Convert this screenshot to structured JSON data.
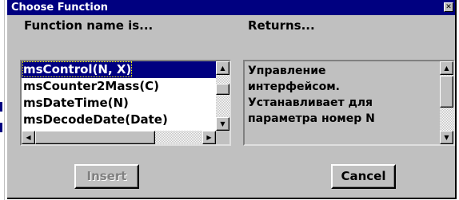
{
  "window": {
    "title": "Choose Function",
    "close_glyph": "✕"
  },
  "left_panel": {
    "label": "Function name is...",
    "items": [
      {
        "label": "msControl(N, X)",
        "selected": true
      },
      {
        "label": "msCounter2Mass(C)",
        "selected": false
      },
      {
        "label": "msDateTime(N)",
        "selected": false
      },
      {
        "label": "msDecodeDate(Date)",
        "selected": false
      }
    ]
  },
  "right_panel": {
    "label": "Returns...",
    "lines": [
      "Управление",
      "интерфейсом.",
      "Устанавливает для",
      "параметра номер N"
    ]
  },
  "buttons": {
    "insert_label": "Insert",
    "insert_enabled": false,
    "cancel_label": "Cancel"
  },
  "scroll_glyphs": {
    "up": "▲",
    "down": "▼",
    "left": "◀",
    "right": "▶"
  },
  "colors": {
    "titlebar": "#000080",
    "face": "#c0c0c0",
    "selection": "#000080"
  }
}
